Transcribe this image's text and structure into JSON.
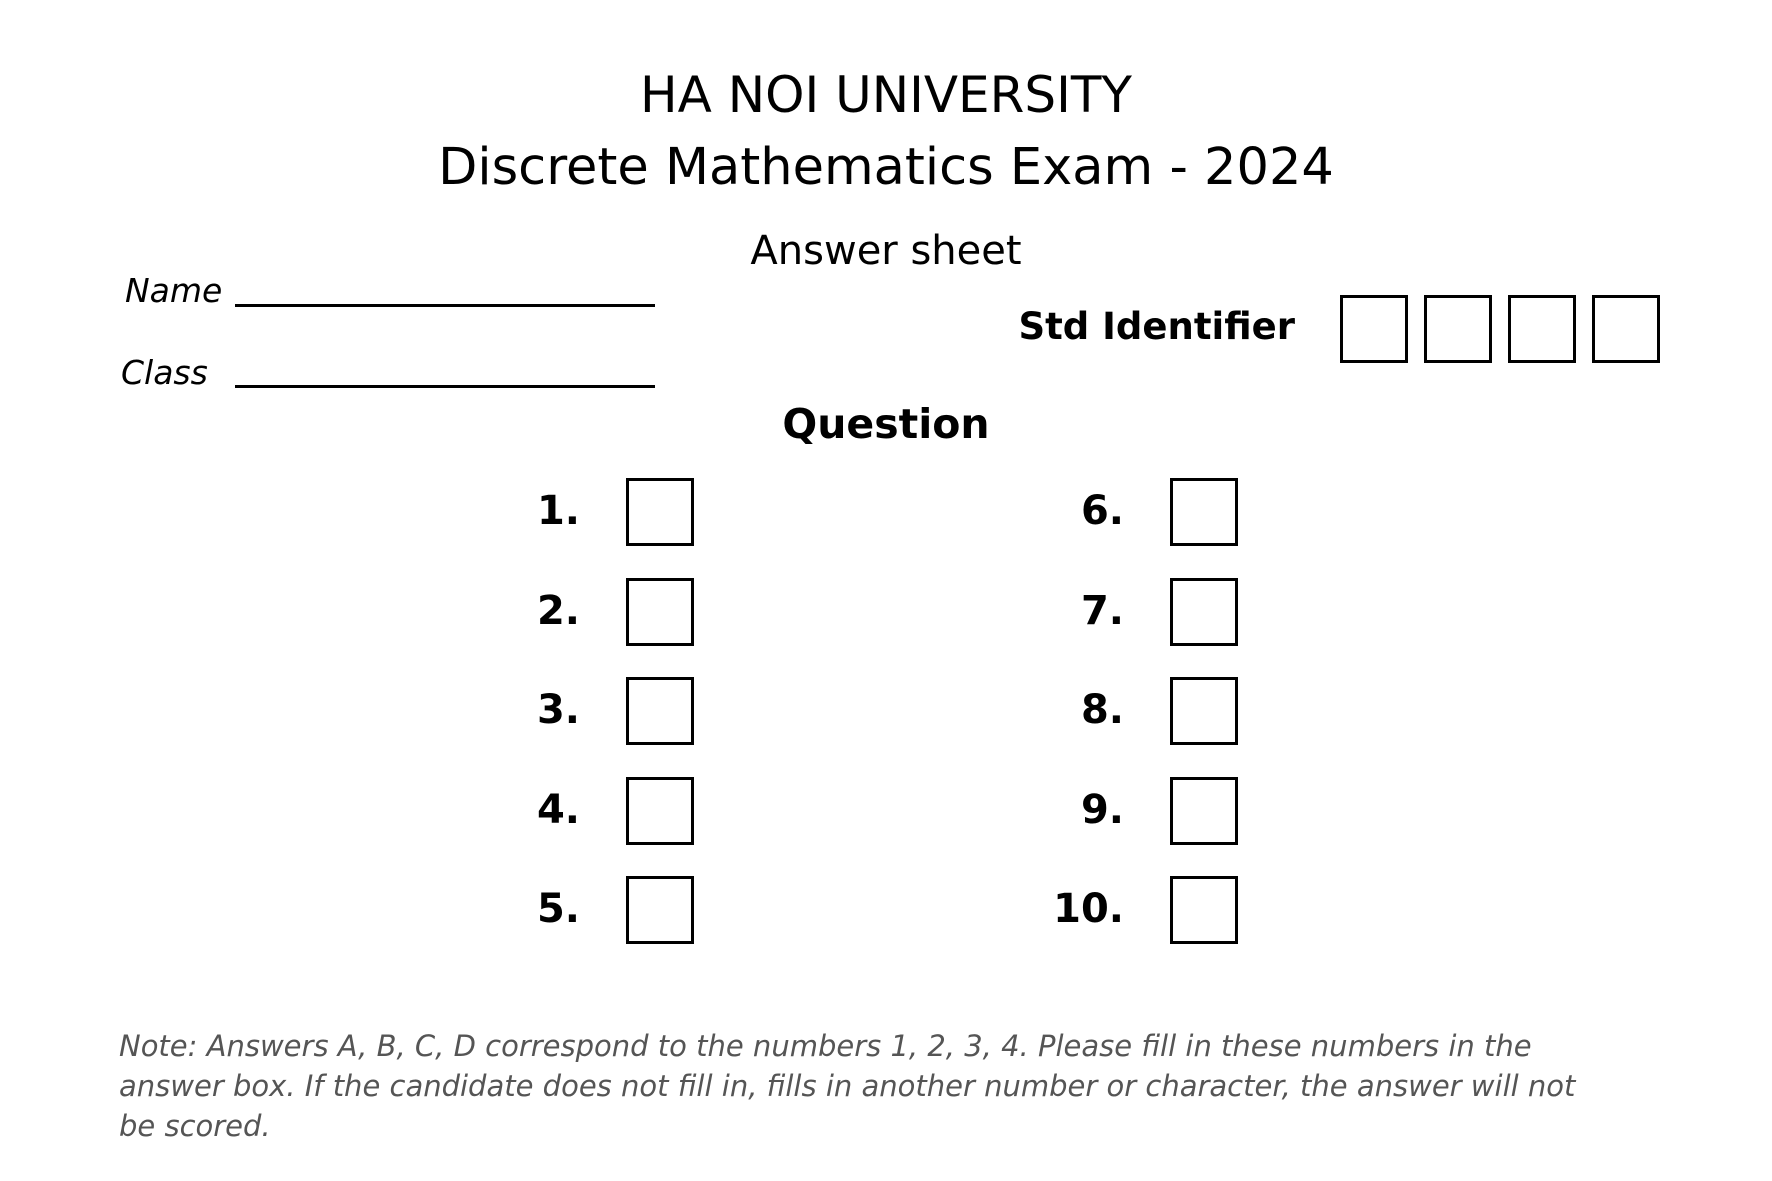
{
  "header": {
    "university": "HA NOI UNIVERSITY",
    "exam_title": "Discrete Mathematics Exam - 2024",
    "sheet_title": "Answer sheet"
  },
  "fields": {
    "name_label": "Name",
    "class_label": "Class",
    "std_identifier_label": "Std Identifier",
    "std_identifier_boxes": 4
  },
  "questions": {
    "title": "Question",
    "left": [
      "1.",
      "2.",
      "3.",
      "4.",
      "5."
    ],
    "right": [
      "6.",
      "7.",
      "8.",
      "9.",
      "10."
    ]
  },
  "note": {
    "text": "Note: Answers A, B, C, D correspond to the numbers 1, 2, 3, 4. Please fill in these numbers in the answer box. If the candidate does not fill in, fills in another number or character, the answer will not be scored."
  },
  "colors": {
    "text": "#000000",
    "note_text": "#555555",
    "background": "#ffffff"
  }
}
